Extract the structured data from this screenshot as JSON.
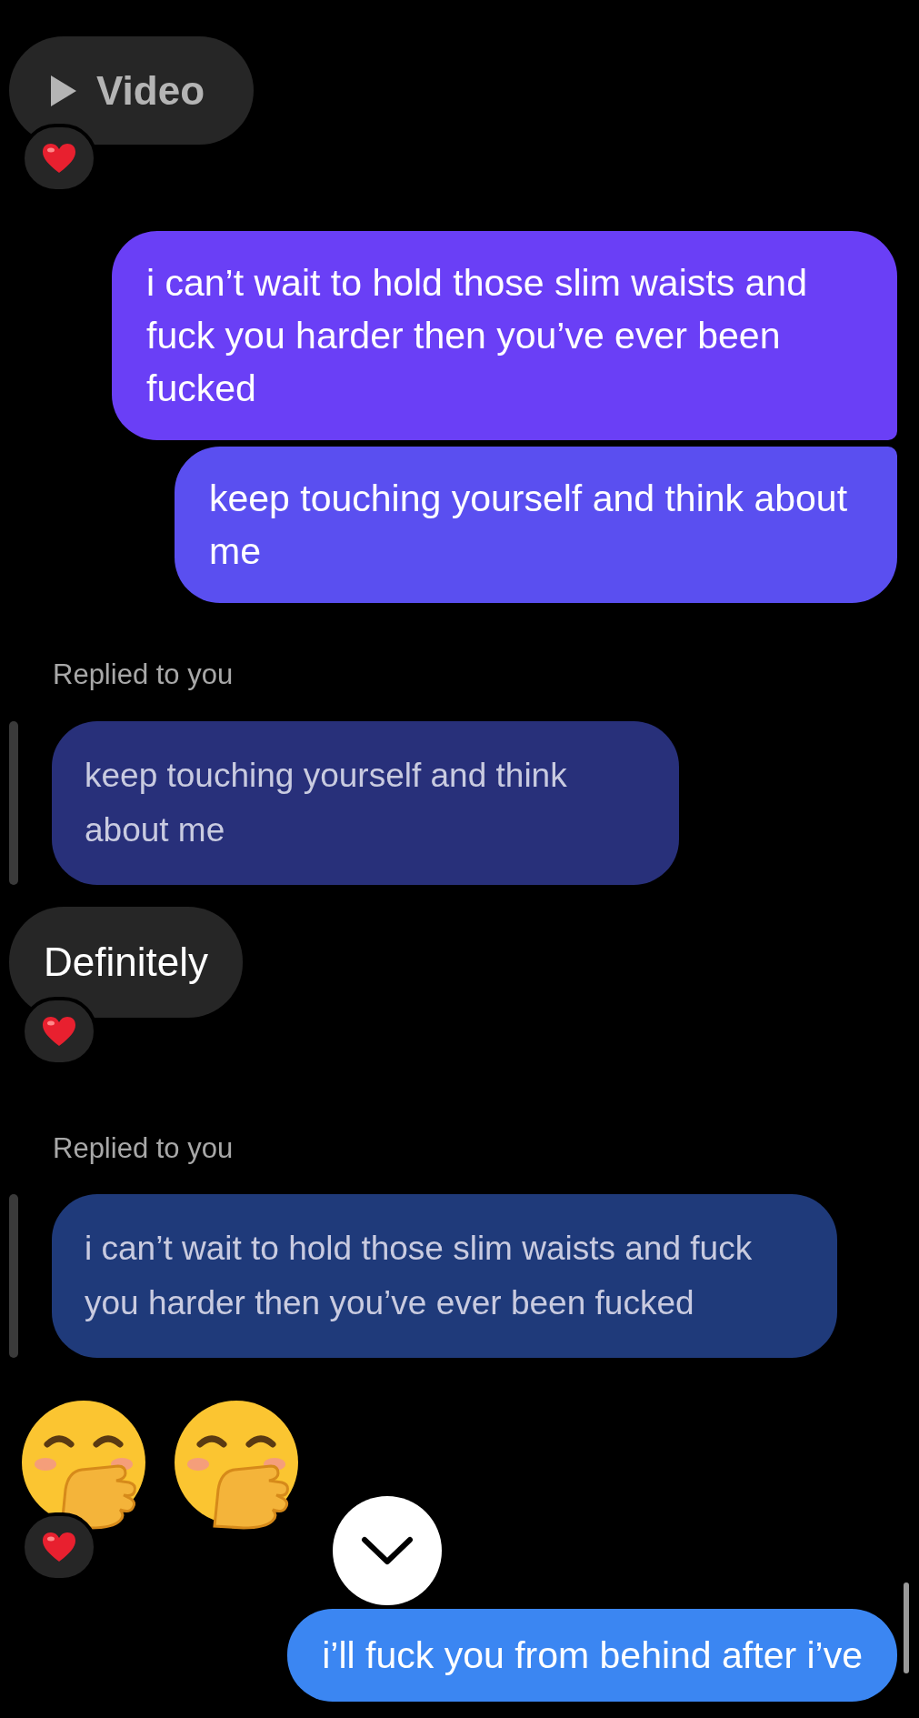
{
  "messages": [
    {
      "kind": "video",
      "text": "Video",
      "reaction": true
    },
    {
      "kind": "sent",
      "text": "i can’t wait to hold those slim waists and fuck you harder then you’ve ever been fucked"
    },
    {
      "kind": "sent",
      "text": "keep touching yourself and think about me"
    },
    {
      "kind": "reply",
      "label": "Replied to you",
      "quote": "keep touching yourself and think about me"
    },
    {
      "kind": "received",
      "text": "Definitely",
      "reaction": true
    },
    {
      "kind": "reply",
      "label": "Replied to you",
      "quote": "i can’t wait to hold those slim waists and fuck you harder then you’ve ever been fucked"
    },
    {
      "kind": "emoji",
      "emojis": [
        {
          "kind": "hand_over_mouth"
        },
        {
          "kind": "hand_over_mouth"
        }
      ],
      "reaction": true
    },
    {
      "kind": "sent",
      "text": "i’ll fuck you from behind after i’ve"
    }
  ]
}
